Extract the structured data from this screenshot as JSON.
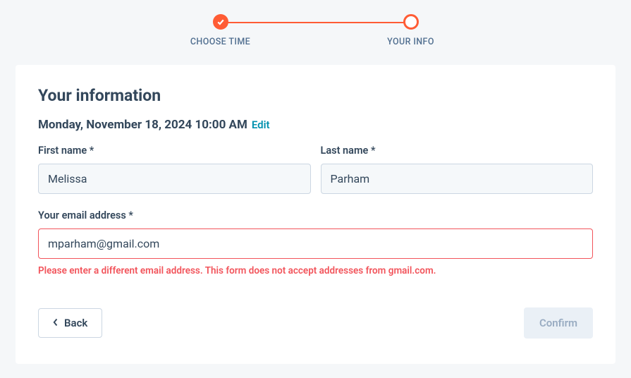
{
  "stepper": {
    "step1": {
      "label": "CHOOSE TIME"
    },
    "step2": {
      "label": "YOUR INFO"
    }
  },
  "form": {
    "heading": "Your information",
    "datetime": "Monday, November 18, 2024 10:00 AM",
    "edit_label": "Edit",
    "first_name_label": "First name *",
    "first_name_value": "Melissa",
    "last_name_label": "Last name *",
    "last_name_value": "Parham",
    "email_label": "Your email address *",
    "email_value": "mparham@gmail.com",
    "email_error": "Please enter a different email address. This form does not accept addresses from gmail.com."
  },
  "actions": {
    "back_label": "Back",
    "confirm_label": "Confirm"
  }
}
